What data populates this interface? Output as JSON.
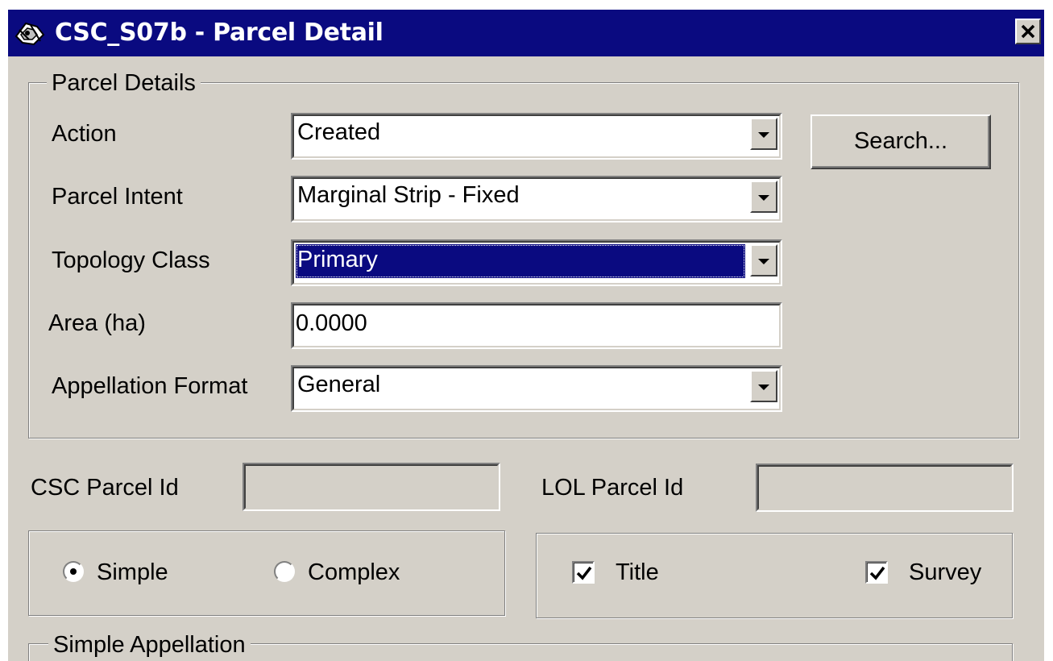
{
  "window": {
    "title": "CSC_S07b - Parcel Detail",
    "close_label": "✕"
  },
  "parcel_details": {
    "legend": "Parcel Details",
    "fields": {
      "action": {
        "label": "Action",
        "value": "Created"
      },
      "parcel_intent": {
        "label": "Parcel Intent",
        "value": "Marginal Strip - Fixed"
      },
      "topology_class": {
        "label": "Topology Class",
        "value": "Primary"
      },
      "area": {
        "label": "Area (ha)",
        "value": "0.0000"
      },
      "appellation_format": {
        "label": "Appellation Format",
        "value": "General"
      }
    },
    "search_button": "Search..."
  },
  "ids": {
    "csc_label": "CSC Parcel Id",
    "csc_value": "",
    "lol_label": "LOL Parcel Id",
    "lol_value": ""
  },
  "type_options": {
    "simple": {
      "label": "Simple",
      "selected": true
    },
    "complex": {
      "label": "Complex",
      "selected": false
    }
  },
  "flags": {
    "title": {
      "label": "Title",
      "checked": true
    },
    "survey": {
      "label": "Survey",
      "checked": true
    }
  },
  "simple_appellation": {
    "legend": "Simple Appellation"
  },
  "colors": {
    "titlebar": "#0a0a80",
    "face": "#d4d0c8",
    "selection": "#0a0a80"
  }
}
